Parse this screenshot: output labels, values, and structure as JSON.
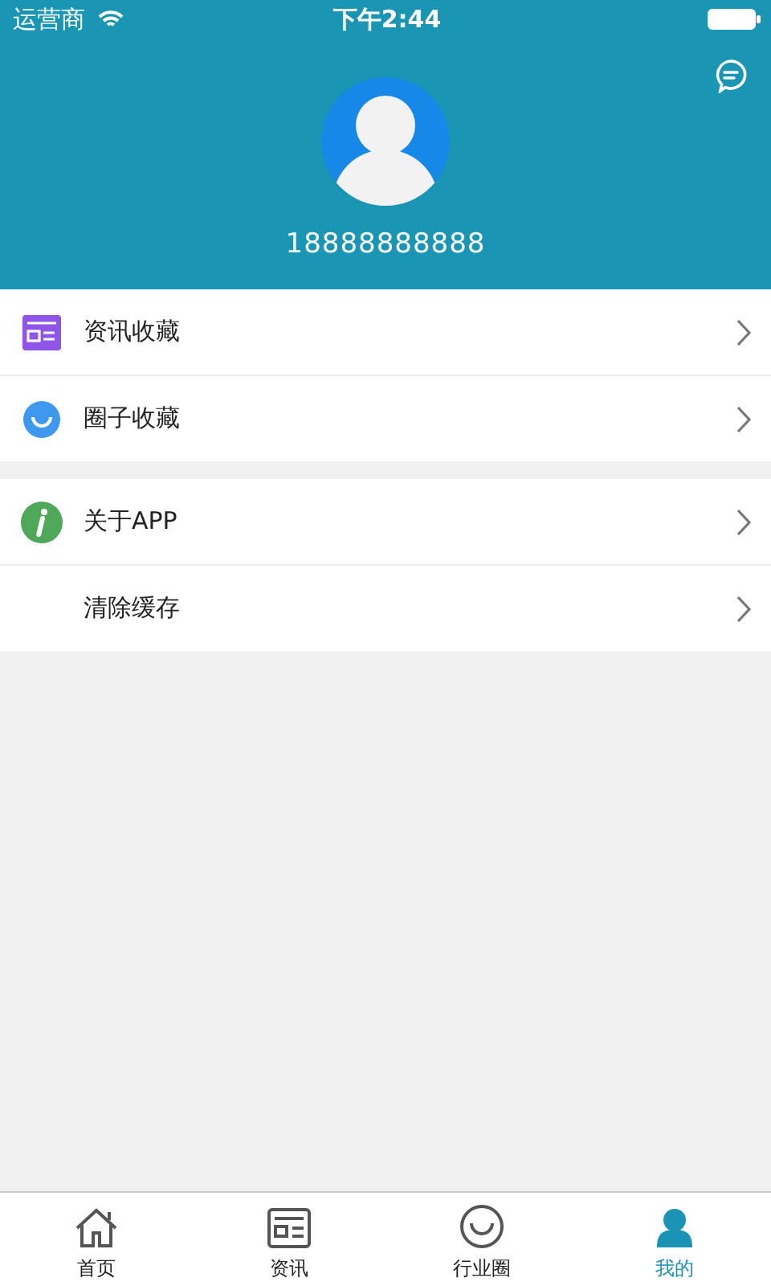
{
  "status_bar": {
    "carrier": "运营商",
    "time": "下午2:44"
  },
  "profile": {
    "phone": "18888888888"
  },
  "menu_groups": [
    {
      "items": [
        {
          "label": "资讯收藏",
          "kind": "news"
        },
        {
          "label": "圈子收藏",
          "kind": "circle"
        }
      ]
    },
    {
      "items": [
        {
          "label": "关于APP",
          "kind": "info"
        },
        {
          "label": "清除缓存",
          "kind": "plain"
        }
      ]
    }
  ],
  "tabs": [
    {
      "label": "首页",
      "kind": "home",
      "selected": false
    },
    {
      "label": "资讯",
      "kind": "news",
      "selected": false
    },
    {
      "label": "行业圈",
      "kind": "circle",
      "selected": false
    },
    {
      "label": "我的",
      "kind": "person",
      "selected": true
    }
  ]
}
